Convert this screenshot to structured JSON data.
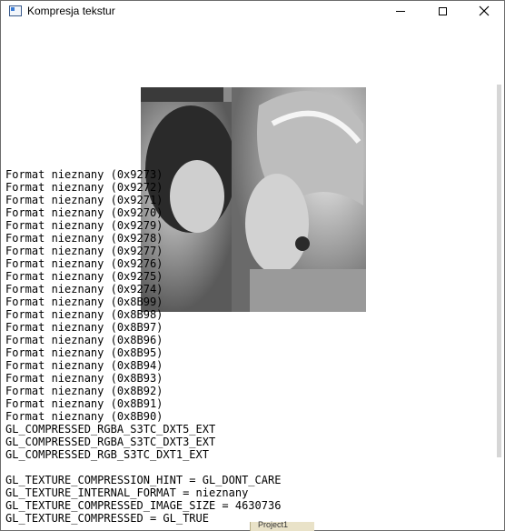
{
  "window": {
    "title": "Kompresja tekstur",
    "icon": "app-window-icon",
    "controls": [
      "minimize",
      "maximize",
      "close"
    ]
  },
  "texture_preview": {
    "description_icon": "texture-image"
  },
  "log": {
    "formats": [
      "Format nieznany (0x9273)",
      "Format nieznany (0x9272)",
      "Format nieznany (0x9271)",
      "Format nieznany (0x9270)",
      "Format nieznany (0x9279)",
      "Format nieznany (0x9278)",
      "Format nieznany (0x9277)",
      "Format nieznany (0x9276)",
      "Format nieznany (0x9275)",
      "Format nieznany (0x9274)",
      "Format nieznany (0x8B99)",
      "Format nieznany (0x8B98)",
      "Format nieznany (0x8B97)",
      "Format nieznany (0x8B96)",
      "Format nieznany (0x8B95)",
      "Format nieznany (0x8B94)",
      "Format nieznany (0x8B93)",
      "Format nieznany (0x8B92)",
      "Format nieznany (0x8B91)",
      "Format nieznany (0x8B90)",
      "GL_COMPRESSED_RGBA_S3TC_DXT5_EXT",
      "GL_COMPRESSED_RGBA_S3TC_DXT3_EXT",
      "GL_COMPRESSED_RGB_S3TC_DXT1_EXT"
    ],
    "status": [
      "GL_TEXTURE_COMPRESSION_HINT = GL_DONT_CARE",
      "GL_TEXTURE_INTERNAL_FORMAT = nieznany",
      "GL_TEXTURE_COMPRESSED_IMAGE_SIZE = 4630736",
      "GL_TEXTURE_COMPRESSED = GL_TRUE"
    ]
  },
  "taskbar": {
    "peek_label": "Project1"
  }
}
